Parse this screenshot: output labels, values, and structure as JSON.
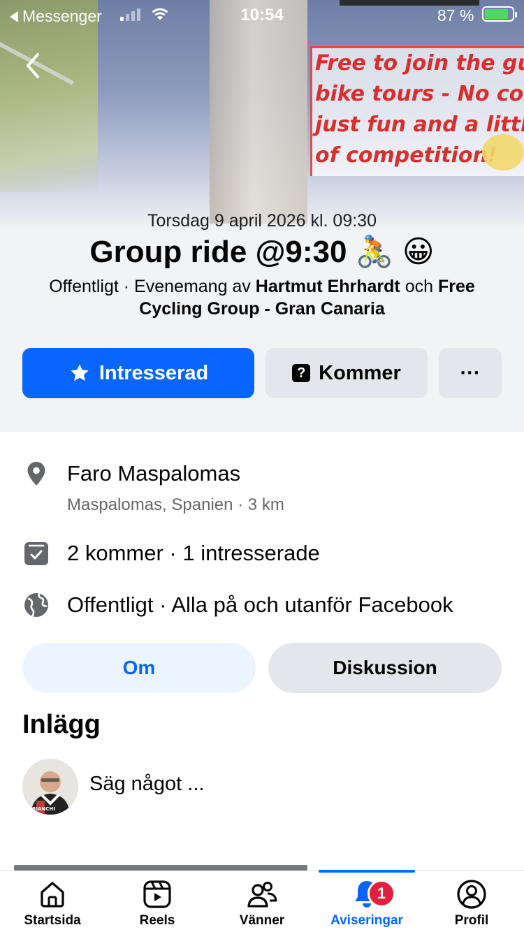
{
  "status_bar": {
    "back_app": "Messenger",
    "time": "10:54",
    "battery_percent": "87 %",
    "battery_level": 0.87
  },
  "cover": {
    "banner_lines": [
      "Free to join the guid",
      "bike tours - No cost,",
      "just fun and a little b",
      "of competition!"
    ]
  },
  "event": {
    "date": "Torsdag 9 april 2026 kl. 09:30",
    "title": "Group ride @9:30 🚴 😀",
    "privacy": "Offentligt",
    "by_prefix": " · Evenemang av ",
    "host1": "Hartmut Ehrhardt",
    "and": " och ",
    "host2": "Free Cycling Group - Gran Canaria"
  },
  "actions": {
    "interested_label": "Intresserad",
    "coming_label": "Kommer",
    "more_label": "···"
  },
  "details": {
    "location_name": "Faro Maspalomas",
    "location_sub": "Maspalomas, Spanien · 3 km",
    "attendance": "2 kommer · 1 intresserade",
    "visibility": "Offentligt · Alla på och utanför Facebook"
  },
  "tabs": {
    "about": "Om",
    "discussion": "Diskussion"
  },
  "posts": {
    "title": "Inlägg",
    "composer_placeholder": "Säg något ..."
  },
  "avatar_text": "BIANCHI",
  "tabbar": {
    "items": [
      {
        "label": "Startsida",
        "icon": "home-icon"
      },
      {
        "label": "Reels",
        "icon": "reels-icon"
      },
      {
        "label": "Vänner",
        "icon": "friends-icon"
      },
      {
        "label": "Aviseringar",
        "icon": "bell-icon"
      },
      {
        "label": "Profil",
        "icon": "profile-icon"
      }
    ],
    "active_index": 3,
    "notification_badge": "1"
  },
  "colors": {
    "accent": "#0866ff",
    "badge": "#e41e3f",
    "secondary_text": "#65676b"
  }
}
